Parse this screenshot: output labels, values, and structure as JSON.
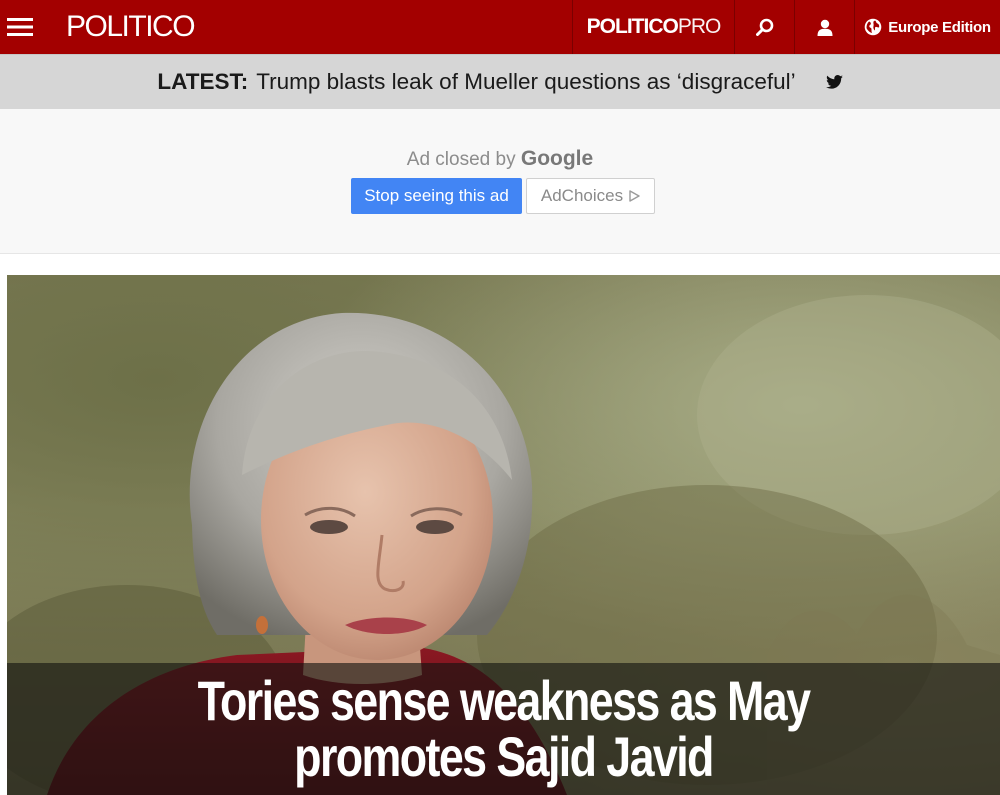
{
  "topnav": {
    "logo": "POLITICO",
    "pro_part1": "POLITICO",
    "pro_part2": "PRO",
    "search_icon": "search-icon",
    "user_icon": "user-icon",
    "edition_label": "Europe Edition",
    "brand_color": "#a30000"
  },
  "latest": {
    "tag": "LATEST:",
    "headline": "Trump blasts leak of Mueller questions as ‘disgraceful’",
    "share_icon": "twitter-icon"
  },
  "ad": {
    "closed_prefix": "Ad closed by",
    "closed_brand": "Google",
    "stop_label": "Stop seeing this ad",
    "choices_label": "AdChoices",
    "stop_color": "#4285f4"
  },
  "hero": {
    "title": "Tories sense weakness as May promotes Sajid Javid"
  }
}
